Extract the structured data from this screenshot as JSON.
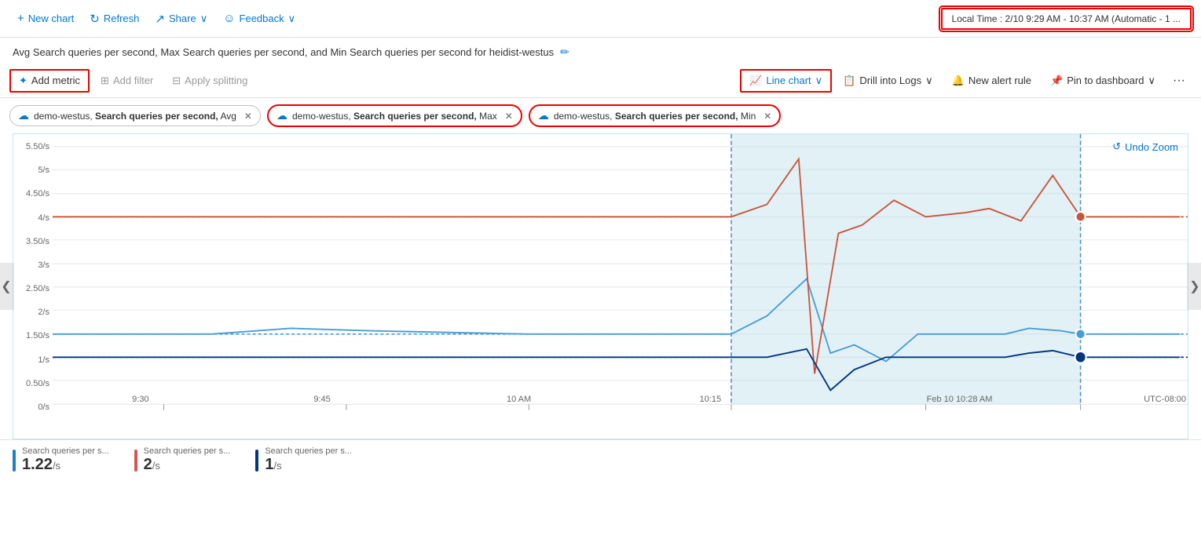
{
  "toolbar": {
    "new_chart": "New chart",
    "refresh": "Refresh",
    "share": "Share",
    "feedback": "Feedback",
    "time_range": "Local Time : 2/10 9:29 AM - 10:37 AM (Automatic - 1 ..."
  },
  "chart_title": "Avg Search queries per second, Max Search queries per second, and Min Search queries per second for heidist-westus",
  "metrics_toolbar": {
    "add_metric": "Add metric",
    "add_filter": "Add filter",
    "apply_splitting": "Apply splitting",
    "chart_type": "Line chart",
    "drill_into_logs": "Drill into Logs",
    "new_alert_rule": "New alert rule",
    "pin_to_dashboard": "Pin to dashboard"
  },
  "metric_tags": [
    {
      "id": "tag1",
      "text": "demo-westus, Search queries per second, Avg",
      "highlighted": false
    },
    {
      "id": "tag2",
      "text": "demo-westus, Search queries per second, Max",
      "highlighted": true
    },
    {
      "id": "tag3",
      "text": "demo-westus, Search queries per second, Min",
      "highlighted": true
    }
  ],
  "chart": {
    "undo_zoom": "Undo Zoom",
    "y_labels": [
      "5.50/s",
      "5/s",
      "4.50/s",
      "4/s",
      "3.50/s",
      "3/s",
      "2.50/s",
      "2/s",
      "1.50/s",
      "1/s",
      "0.50/s",
      "0/s"
    ],
    "x_labels": [
      "9:30",
      "9:45",
      "10 AM",
      "10:15",
      "Feb 10 10:28 AM",
      "UTC-08:00"
    ]
  },
  "legend": [
    {
      "label": "Search queries per s...",
      "color": "#1e7fc3",
      "value": "1.22",
      "unit": "/s"
    },
    {
      "label": "Search queries per s...",
      "color": "#d9534f",
      "value": "2",
      "unit": "/s"
    },
    {
      "label": "Search queries per s...",
      "color": "#003580",
      "value": "1",
      "unit": "/s"
    }
  ],
  "icons": {
    "plus": "+",
    "refresh": "↻",
    "share": "↗",
    "smiley": "☺",
    "chevron_down": "∨",
    "pencil": "✏",
    "metric_plus": "✦",
    "filter": "⊞",
    "split": "⊟",
    "line_chart": "📈",
    "logs": "📋",
    "alert": "🔔",
    "pin": "📌",
    "cloud": "☁",
    "close": "✕",
    "undo": "↺",
    "arrow_left": "❮",
    "arrow_right": "❯"
  }
}
